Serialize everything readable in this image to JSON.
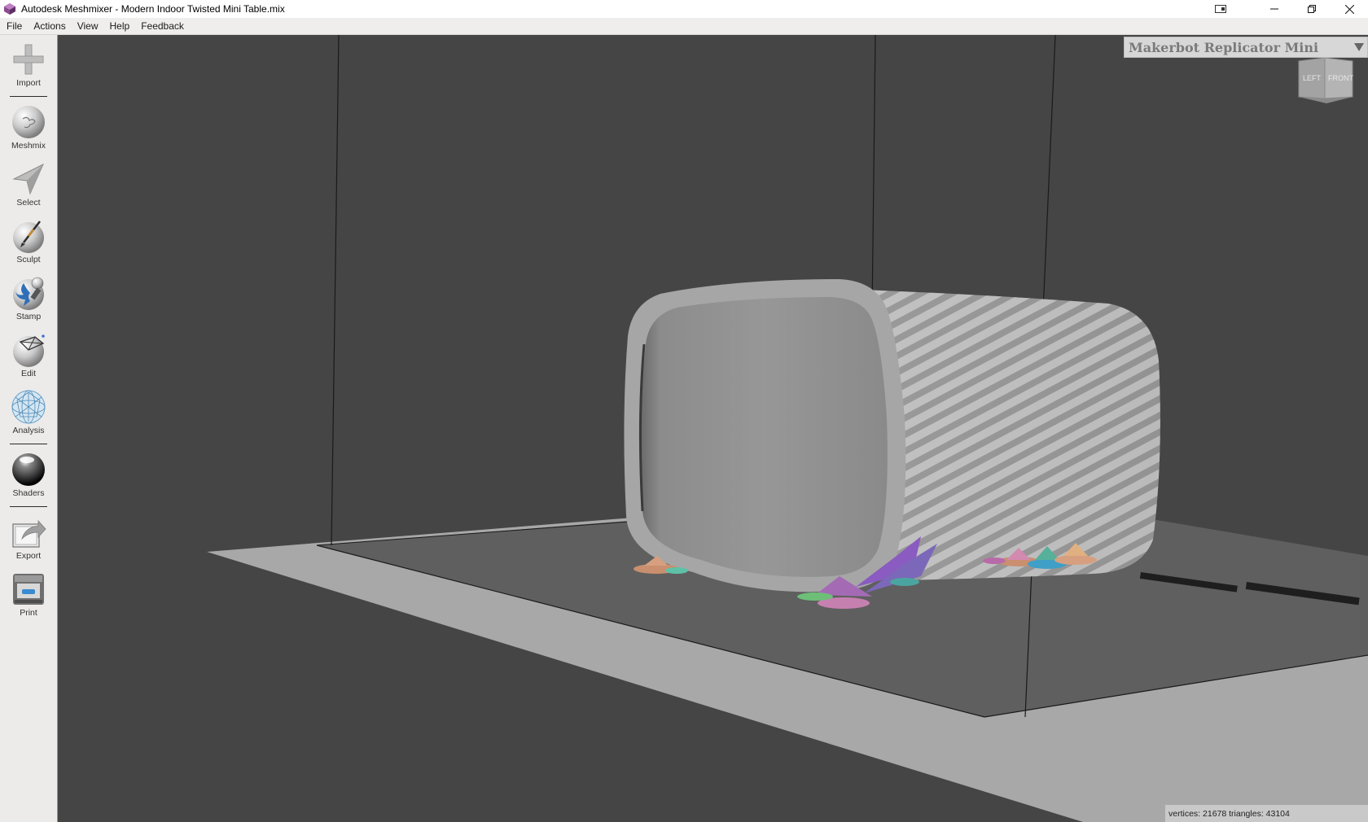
{
  "window": {
    "title": "Autodesk Meshmixer - Modern Indoor Twisted Mini Table.mix",
    "app_icon": "meshmixer-logo-icon",
    "controls": [
      "minimize-icon",
      "restore-icon",
      "close-icon"
    ]
  },
  "menu": {
    "items": [
      "File",
      "Actions",
      "View",
      "Help",
      "Feedback"
    ]
  },
  "toolbar": {
    "tools": [
      {
        "label": "Import",
        "icon": "plus-icon"
      },
      {
        "label": "Meshmix",
        "icon": "bunny-sphere-icon"
      },
      {
        "label": "Select",
        "icon": "arrow-cursor-icon"
      },
      {
        "label": "Sculpt",
        "icon": "brush-sphere-icon"
      },
      {
        "label": "Stamp",
        "icon": "fleur-de-lis-sphere-icon"
      },
      {
        "label": "Edit",
        "icon": "cube-sphere-icon"
      },
      {
        "label": "Analysis",
        "icon": "wireframe-sphere-icon"
      },
      {
        "label": "Shaders",
        "icon": "glossy-sphere-icon"
      },
      {
        "label": "Export",
        "icon": "export-icon"
      },
      {
        "label": "Print",
        "icon": "printer-icon"
      }
    ]
  },
  "viewport": {
    "printer": "Makerbot Replicator Mini",
    "viewcube": {
      "left": "LEFT",
      "front": "FRONT"
    },
    "status": "vertices: 21678  triangles: 43104",
    "background_color": "#454545"
  }
}
